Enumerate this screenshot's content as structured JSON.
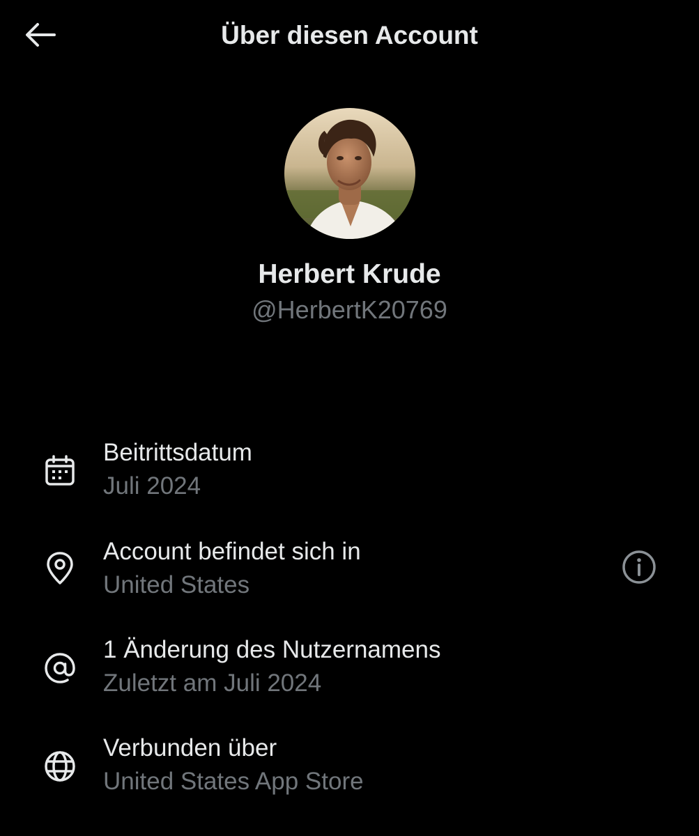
{
  "header": {
    "title": "Über diesen Account",
    "back_icon": "arrow-left-icon"
  },
  "profile": {
    "display_name": "Herbert Krude",
    "handle": "@HerbertK20769",
    "avatar": "profile-photo"
  },
  "details": [
    {
      "icon": "calendar-icon",
      "label": "Beitrittsdatum",
      "value": "Juli 2024"
    },
    {
      "icon": "location-pin-icon",
      "label": "Account befindet sich in",
      "value": "United States",
      "action_icon": "info-icon"
    },
    {
      "icon": "at-sign-icon",
      "label": "1 Änderung des Nutzernamens",
      "value": "Zuletzt am Juli 2024"
    },
    {
      "icon": "globe-icon",
      "label": "Verbunden über",
      "value": "United States App Store"
    }
  ],
  "colors": {
    "background": "#000000",
    "primary_text": "#e7e9ea",
    "secondary_text": "#71767b"
  }
}
